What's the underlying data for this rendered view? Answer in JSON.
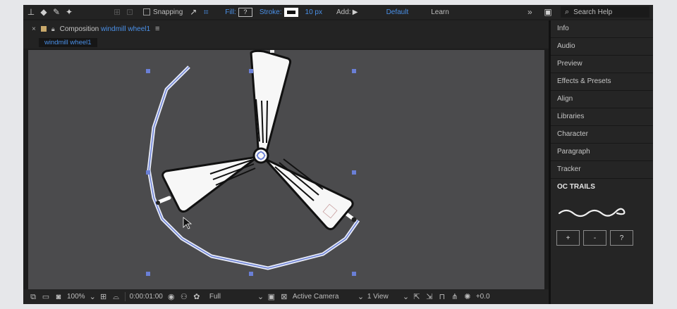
{
  "toolbar": {
    "snapping_label": "Snapping",
    "fill_label": "Fill:",
    "fill_value": "?",
    "stroke_label": "Stroke:",
    "stroke_width": "10 px",
    "add_label": "Add:",
    "workspace_default": "Default",
    "workspace_learn": "Learn",
    "overflow": "»",
    "search_placeholder": "Search Help"
  },
  "composition": {
    "close_glyph": "×",
    "tab_prefix": "Composition",
    "tab_name": "windmill wheel1",
    "subtab": "windmill wheel1"
  },
  "viewer_bar": {
    "zoom": "100%",
    "timecode": "0:00:01:00",
    "resolution": "Full",
    "camera": "Active Camera",
    "views": "1 View",
    "exposure": "+0.0"
  },
  "panels": {
    "items": [
      "Info",
      "Audio",
      "Preview",
      "Effects & Presets",
      "Align",
      "Libraries",
      "Character",
      "Paragraph",
      "Tracker"
    ],
    "oc_trails": {
      "title": "OC TRAILS",
      "buttons": [
        "+",
        "-",
        "?"
      ]
    }
  },
  "colors": {
    "accent": "#4a90e8",
    "viewer_bg": "#4b4b4d",
    "app_bg": "#1d1d1d",
    "handle": "#6a7fd6"
  }
}
